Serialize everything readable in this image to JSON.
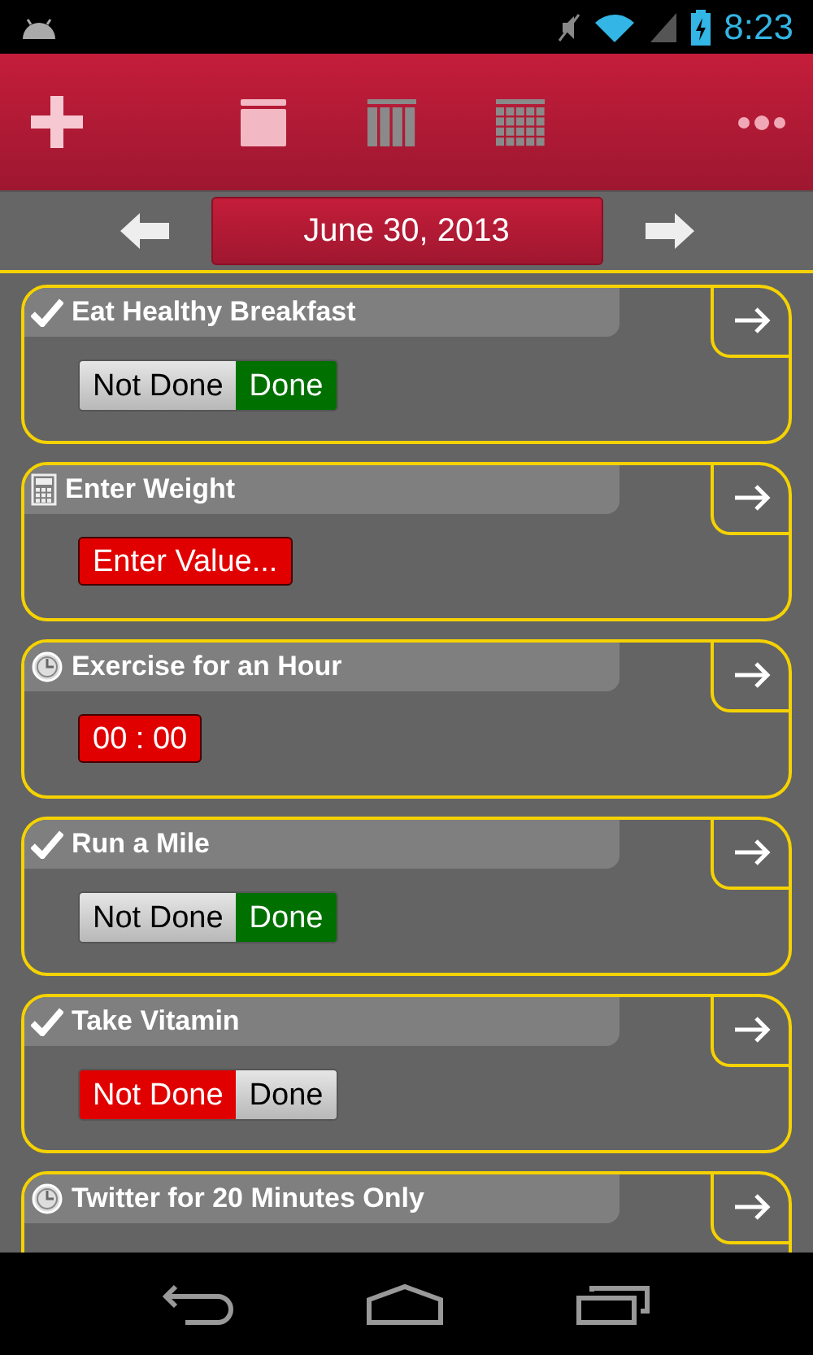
{
  "status_bar": {
    "time": "8:23"
  },
  "toolbar": {
    "views": [
      {
        "selected": true
      },
      {
        "selected": false
      },
      {
        "selected": false
      }
    ]
  },
  "date_nav": {
    "date": "June 30, 2013"
  },
  "tasks": [
    {
      "title": "Eat Healthy Breakfast",
      "kind": "toggle",
      "options": [
        {
          "label": "Not Done",
          "selected": false
        },
        {
          "label": "Done",
          "selected": true
        }
      ]
    },
    {
      "title": "Enter Weight",
      "kind": "value",
      "button": "Enter Value..."
    },
    {
      "title": "Exercise for an Hour",
      "kind": "timer",
      "button": "00 : 00"
    },
    {
      "title": "Run a Mile",
      "kind": "toggle",
      "options": [
        {
          "label": "Not Done",
          "selected": false
        },
        {
          "label": "Done",
          "selected": true
        }
      ]
    },
    {
      "title": "Take Vitamin",
      "kind": "toggle",
      "options": [
        {
          "label": "Not Done",
          "selected": true
        },
        {
          "label": "Done",
          "selected": false
        }
      ]
    },
    {
      "title": "Twitter for 20 Minutes Only",
      "kind": "timer"
    }
  ]
}
